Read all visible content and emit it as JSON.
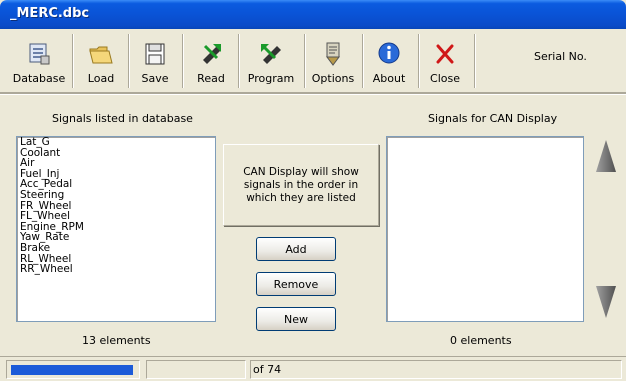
{
  "window": {
    "title": "_MERC.dbc"
  },
  "toolbar": {
    "buttons": [
      {
        "label": "Database",
        "icon": "database-icon"
      },
      {
        "label": "Load",
        "icon": "folder-open-icon"
      },
      {
        "label": "Save",
        "icon": "floppy-disk-icon"
      },
      {
        "label": "Read",
        "icon": "read-icon"
      },
      {
        "label": "Program",
        "icon": "program-icon"
      },
      {
        "label": "Options",
        "icon": "options-icon"
      },
      {
        "label": "About",
        "icon": "info-icon"
      },
      {
        "label": "Close",
        "icon": "close-icon"
      }
    ],
    "serial_label": "Serial No."
  },
  "left_panel": {
    "header": "Signals listed in database",
    "items": [
      "Lat_G",
      "Coolant",
      "Air",
      "Fuel_Inj",
      "Acc_Pedal",
      "Steering",
      "FR_Wheel",
      "FL_Wheel",
      "Engine_RPM",
      "Yaw_Rate",
      "Brake",
      "RL_Wheel",
      "RR_Wheel"
    ],
    "count": "13 elements"
  },
  "center": {
    "info_text": "CAN Display will show signals in the order in which they are listed",
    "add_label": "Add",
    "remove_label": "Remove",
    "new_label": "New"
  },
  "right_panel": {
    "header": "Signals for CAN Display",
    "count": "0 elements"
  },
  "statusbar": {
    "page_text": "of 74"
  },
  "colors": {
    "titlebar": "#0A53D6",
    "progress": "#1C5BD8",
    "arrow": "#808080"
  }
}
